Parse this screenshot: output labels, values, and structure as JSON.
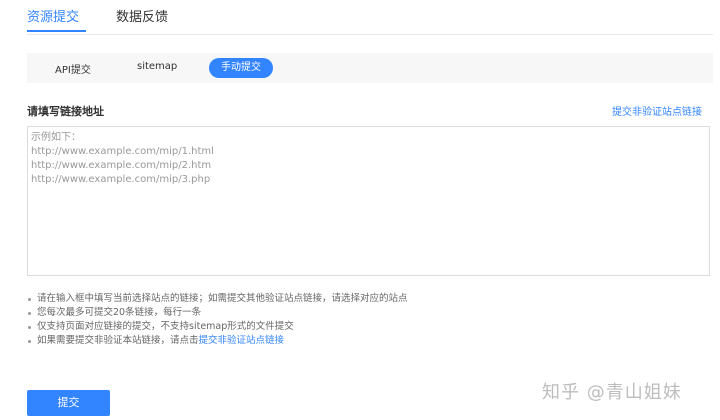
{
  "top_tabs": [
    {
      "label": "资源提交",
      "active": true
    },
    {
      "label": "数据反馈",
      "active": false
    }
  ],
  "sub_tabs": [
    {
      "label": "API提交",
      "active": false
    },
    {
      "label": "sitemap",
      "active": false
    },
    {
      "label": "手动提交",
      "active": true
    }
  ],
  "form": {
    "title": "请填写链接地址",
    "right_link": "提交非验证站点链接",
    "placeholder_lines": [
      "示例如下：",
      "http://www.example.com/mip/1.html",
      "http://www.example.com/mip/2.htm",
      "http://www.example.com/mip/3.php"
    ]
  },
  "tips": [
    {
      "text": "请在输入框中填写当前选择站点的链接；如需提交其他验证站点链接，请选择对应的站点",
      "link": ""
    },
    {
      "text": "您每次最多可提交20条链接，每行一条",
      "link": ""
    },
    {
      "text": "仅支持页面对应链接的提交，不支持sitemap形式的文件提交",
      "link": ""
    },
    {
      "text": "如果需要提交非验证本站链接，请点击",
      "link": "提交非验证站点链接"
    }
  ],
  "submit_label": "提交",
  "watermark": "知乎 @青山姐妹",
  "colors": {
    "accent": "#3385ff",
    "placeholder": "#999999",
    "bar_bg": "#f7f7f7"
  }
}
